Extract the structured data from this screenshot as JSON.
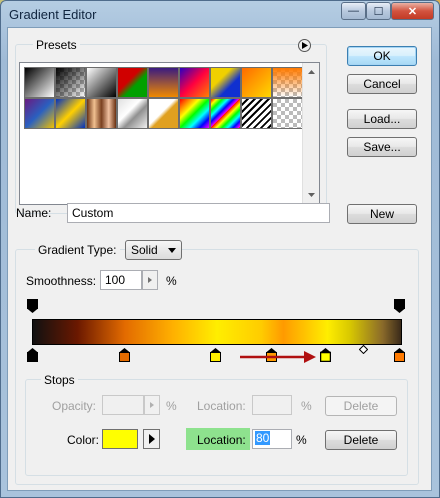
{
  "window": {
    "title": "Gradient Editor",
    "minimize_glyph": "—",
    "maximize_glyph": "☐",
    "close_glyph": "✕"
  },
  "presets": {
    "label": "Presets",
    "menu_icon": "triangle-right-circle-icon"
  },
  "buttons": {
    "ok": "OK",
    "cancel": "Cancel",
    "load": "Load...",
    "save": "Save...",
    "new": "New"
  },
  "name": {
    "label": "Name:",
    "value": "Custom"
  },
  "gradient": {
    "type_label": "Gradient Type:",
    "type_value": "Solid",
    "smoothness_label": "Smoothness:",
    "smoothness_value": "100",
    "smoothness_unit": "%"
  },
  "stops": {
    "label": "Stops",
    "opacity_label": "Opacity:",
    "opacity_value": "",
    "opacity_unit": "%",
    "opacity_location_label": "Location:",
    "opacity_location_value": "",
    "opacity_location_unit": "%",
    "delete_label": "Delete",
    "color_label": "Color:",
    "color_value": "#ffff00",
    "color_location_label": "Location:",
    "color_location_value": "80",
    "color_location_unit": "%",
    "delete2_label": "Delete"
  },
  "colors": {
    "accent": "#3399ff",
    "location_highlight": "#8ee28e",
    "arrow": "#b01010"
  }
}
